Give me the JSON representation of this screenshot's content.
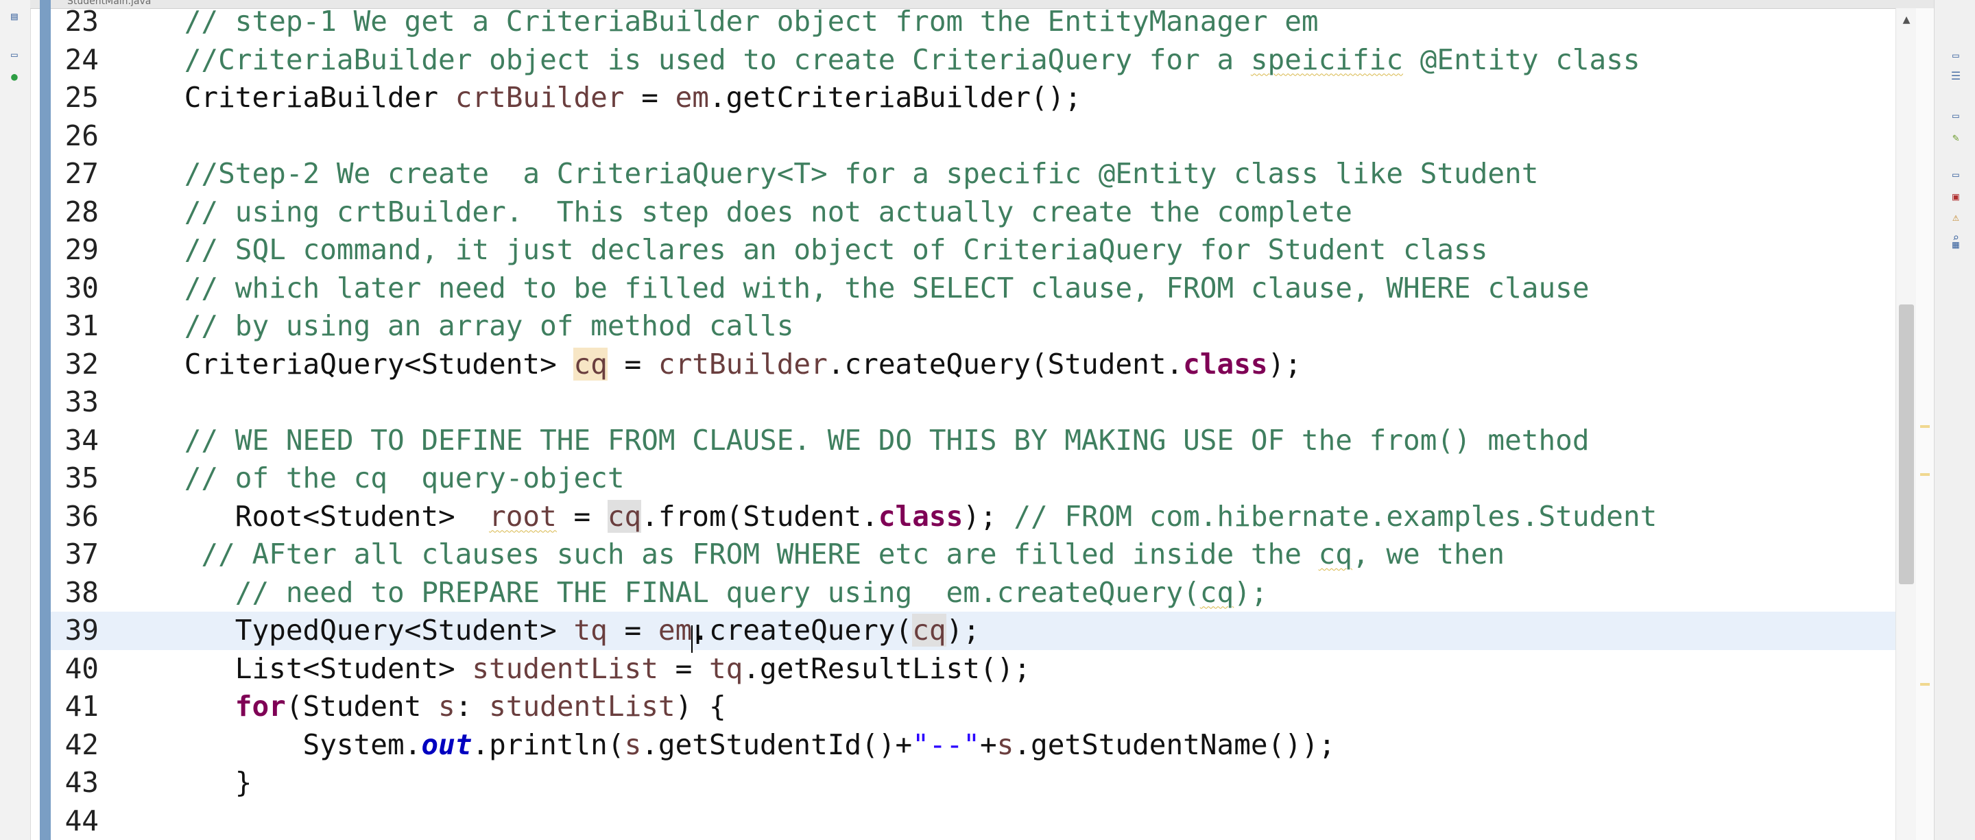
{
  "window": {
    "tab_label": "StudentMain.java"
  },
  "editor": {
    "lines": [
      {
        "num": "23",
        "segments": [
          {
            "t": "    "
          },
          {
            "t": "// step-1 We get a CriteriaBuilder object from the EntityManager em",
            "c": "tok-c"
          }
        ]
      },
      {
        "num": "24",
        "segments": [
          {
            "t": "    "
          },
          {
            "t": "//CriteriaBuilder object is used to create CriteriaQuery for a ",
            "c": "tok-c"
          },
          {
            "t": "speicific",
            "c": "tok-c squig"
          },
          {
            "t": " @Entity class",
            "c": "tok-c"
          }
        ]
      },
      {
        "num": "25",
        "segments": [
          {
            "t": "    CriteriaBuilder "
          },
          {
            "t": "crtBuilder",
            "c": "tok-v"
          },
          {
            "t": " = "
          },
          {
            "t": "em",
            "c": "tok-v"
          },
          {
            "t": ".getCriteriaBuilder();"
          }
        ]
      },
      {
        "num": "26",
        "segments": [
          {
            "t": ""
          }
        ]
      },
      {
        "num": "27",
        "segments": [
          {
            "t": "    "
          },
          {
            "t": "//Step-2 We create  a CriteriaQuery<T> for a specific @Entity class like Student",
            "c": "tok-c"
          }
        ]
      },
      {
        "num": "28",
        "segments": [
          {
            "t": "    "
          },
          {
            "t": "// using crtBuilder.  This step does not actually create the complete",
            "c": "tok-c"
          }
        ]
      },
      {
        "num": "29",
        "segments": [
          {
            "t": "    "
          },
          {
            "t": "// SQL command, it just declares an object of CriteriaQuery for Student class",
            "c": "tok-c"
          }
        ]
      },
      {
        "num": "30",
        "segments": [
          {
            "t": "    "
          },
          {
            "t": "// which later need to be filled with, the SELECT clause, FROM clause, WHERE clause",
            "c": "tok-c"
          }
        ]
      },
      {
        "num": "31",
        "segments": [
          {
            "t": "    "
          },
          {
            "t": "// by using an array of method calls",
            "c": "tok-c"
          }
        ]
      },
      {
        "num": "32",
        "segments": [
          {
            "t": "    CriteriaQuery<Student> "
          },
          {
            "t": "cq",
            "c": "tok-v tok-hl"
          },
          {
            "t": " = "
          },
          {
            "t": "crtBuilder",
            "c": "tok-v"
          },
          {
            "t": ".createQuery(Student."
          },
          {
            "t": "class",
            "c": "tok-k"
          },
          {
            "t": ");"
          }
        ]
      },
      {
        "num": "33",
        "segments": [
          {
            "t": ""
          }
        ]
      },
      {
        "num": "34",
        "segments": [
          {
            "t": "    "
          },
          {
            "t": "// WE NEED TO DEFINE THE FROM CLAUSE. WE DO THIS BY MAKING USE OF the from() method",
            "c": "tok-c"
          }
        ]
      },
      {
        "num": "35",
        "segments": [
          {
            "t": "    "
          },
          {
            "t": "// of the cq  query-object",
            "c": "tok-c"
          }
        ]
      },
      {
        "num": "36",
        "segments": [
          {
            "t": "       Root<Student>  "
          },
          {
            "t": "root",
            "c": "tok-v squig"
          },
          {
            "t": " = "
          },
          {
            "t": "cq",
            "c": "tok-v tok-hl2"
          },
          {
            "t": ".from(Student."
          },
          {
            "t": "class",
            "c": "tok-k"
          },
          {
            "t": "); "
          },
          {
            "t": "// FROM com.hibernate.examples.Student",
            "c": "tok-c"
          }
        ]
      },
      {
        "num": "37",
        "segments": [
          {
            "t": "     "
          },
          {
            "t": "// AFter all clauses such as FROM WHERE etc are filled inside the ",
            "c": "tok-c"
          },
          {
            "t": "cq",
            "c": "tok-c squig"
          },
          {
            "t": ", we then",
            "c": "tok-c"
          }
        ]
      },
      {
        "num": "38",
        "segments": [
          {
            "t": "       "
          },
          {
            "t": "// need to PREPARE THE FINAL query using  em.createQuery(",
            "c": "tok-c"
          },
          {
            "t": "cq",
            "c": "tok-c squig"
          },
          {
            "t": ");",
            "c": "tok-c"
          }
        ]
      },
      {
        "num": "39",
        "current": true,
        "segments": [
          {
            "t": "       TypedQuery<Student> "
          },
          {
            "t": "tq",
            "c": "tok-v"
          },
          {
            "t": " = "
          },
          {
            "t": "em",
            "c": "tok-v"
          },
          {
            "t": ".createQuery("
          },
          {
            "t": "cq",
            "c": "tok-v tok-hl2"
          },
          {
            "t": ");"
          }
        ]
      },
      {
        "num": "40",
        "segments": [
          {
            "t": "       List<Student> "
          },
          {
            "t": "studentList",
            "c": "tok-v"
          },
          {
            "t": " = "
          },
          {
            "t": "tq",
            "c": "tok-v"
          },
          {
            "t": ".getResultList();"
          }
        ]
      },
      {
        "num": "41",
        "segments": [
          {
            "t": "       "
          },
          {
            "t": "for",
            "c": "tok-k"
          },
          {
            "t": "(Student "
          },
          {
            "t": "s",
            "c": "tok-v"
          },
          {
            "t": ": "
          },
          {
            "t": "studentList",
            "c": "tok-v"
          },
          {
            "t": ") {"
          }
        ]
      },
      {
        "num": "42",
        "segments": [
          {
            "t": "           System."
          },
          {
            "t": "out",
            "c": "tok-f"
          },
          {
            "t": ".println("
          },
          {
            "t": "s",
            "c": "tok-v"
          },
          {
            "t": ".getStudentId()+"
          },
          {
            "t": "\"--\"",
            "c": "tok-s"
          },
          {
            "t": "+"
          },
          {
            "t": "s",
            "c": "tok-v"
          },
          {
            "t": ".getStudentName());"
          }
        ]
      },
      {
        "num": "43",
        "segments": [
          {
            "t": "       }"
          }
        ]
      },
      {
        "num": "44",
        "segments": [
          {
            "t": ""
          }
        ]
      }
    ]
  },
  "icons": {
    "left_toolbar": [
      "show-view-icon",
      "minimize-icon",
      "run-status-icon"
    ],
    "right_toolbar": [
      "restore-icon",
      "outline-icon",
      "minimize-icon",
      "task-icon",
      "minimize-icon",
      "console-icon",
      "problems-icon",
      "search-icon",
      "properties-icon"
    ],
    "scroll_up": "chevron-up-icon"
  }
}
